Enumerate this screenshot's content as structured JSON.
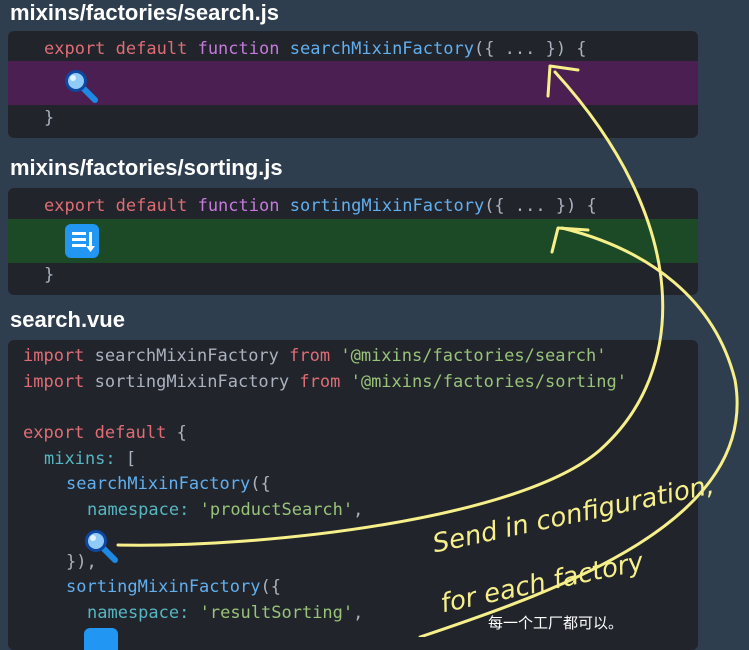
{
  "files": {
    "search_factory": {
      "title": "mixins/factories/search.js",
      "line1": {
        "kw1": "export",
        "kw2": "default",
        "kw3": "function",
        "fn": "searchMixinFactory",
        "rest": "({ ... }) {"
      },
      "closing": "}"
    },
    "sorting_factory": {
      "title": "mixins/factories/sorting.js",
      "line1": {
        "kw1": "export",
        "kw2": "default",
        "kw3": "function",
        "fn": "sortingMixinFactory",
        "rest": "({ ... }) {"
      },
      "closing": "}"
    },
    "search_vue": {
      "title": "search.vue",
      "import1": {
        "kw": "import",
        "name": "searchMixinFactory",
        "from": "from",
        "path": "'@mixins/factories/search'"
      },
      "import2": {
        "kw": "import",
        "name": "sortingMixinFactory",
        "from": "from",
        "path": "'@mixins/factories/sorting'"
      },
      "export_line": {
        "kw1": "export",
        "kw2": "default",
        "brace": "{"
      },
      "mixins_line": {
        "key": "mixins:",
        "bracket": "["
      },
      "call1": {
        "fn": "searchMixinFactory",
        "paren": "({"
      },
      "ns1": {
        "key": "namespace:",
        "val": "'productSearch'",
        "comma": ","
      },
      "close1": "}),",
      "call2": {
        "fn": "sortingMixinFactory",
        "paren": "({"
      },
      "ns2": {
        "key": "namespace:",
        "val": "'resultSorting'",
        "comma": ","
      }
    }
  },
  "annotation": {
    "line1": "Send in configuration,",
    "line2": "for each factory",
    "color": "#f6ef8a"
  },
  "caption": "每一个工厂都可以。",
  "colors": {
    "background": "#2f3e4f",
    "panel": "#21252b",
    "band_purple": "#4b1f51",
    "band_green": "#1c4a27",
    "icon_blue": "#2196f3"
  },
  "icons": {
    "search": "magnifier-icon",
    "sort": "list-sort-icon"
  }
}
